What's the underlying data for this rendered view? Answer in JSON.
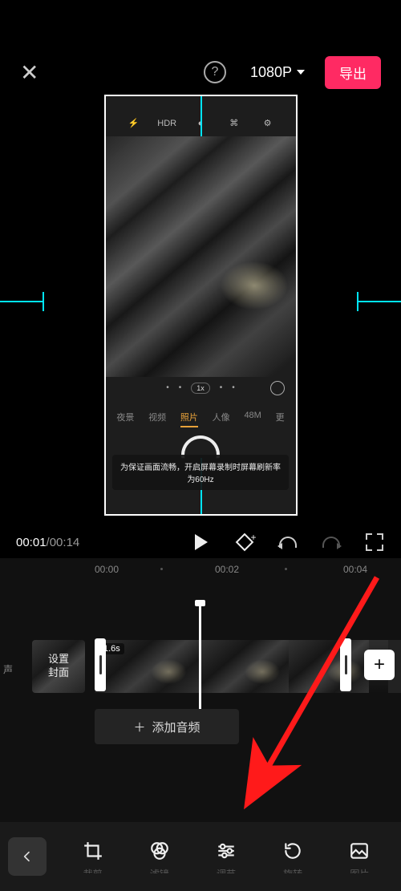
{
  "header": {
    "resolution_label": "1080P",
    "export_label": "导出"
  },
  "preview": {
    "topbar_hdr": "HDR",
    "zoom_label": "1x",
    "tabs": {
      "night": "夜景",
      "video": "视频",
      "photo": "照片",
      "portrait": "人像",
      "fortyeight": "48M",
      "more": "更"
    },
    "toast_line1": "为保证画面流畅，开启屏幕录制时屏幕刷新率",
    "toast_line2": "为60Hz"
  },
  "playback": {
    "current_time": "00:01",
    "total_time": "00:14"
  },
  "timeline": {
    "ruler": {
      "t0": "00:00",
      "t2": "00:02",
      "t4": "00:04"
    },
    "cover_label_l1": "设置",
    "cover_label_l2": "封面",
    "clip_duration": "1.6s",
    "mute_text": "声",
    "add_audio_label": "添加音频",
    "add_audio_prefix": "＋"
  },
  "toolbar": {
    "crop": "裁剪",
    "filter": "滤镜",
    "adjust": "调节",
    "rotate": "旋转",
    "image": "图片"
  }
}
